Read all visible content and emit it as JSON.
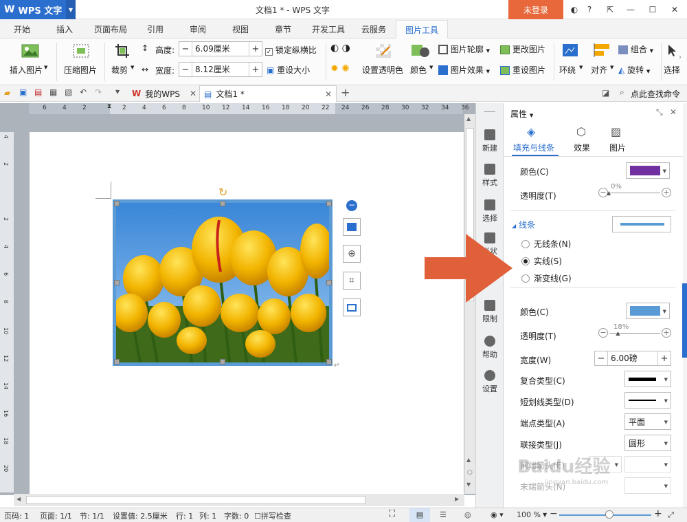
{
  "title_bar": {
    "app_name": "WPS 文字",
    "doc_title": "文档1 * - WPS 文字",
    "login_button": "未登录",
    "help_label": "?"
  },
  "menu_tabs": [
    "开始",
    "插入",
    "页面布局",
    "引用",
    "审阅",
    "视图",
    "章节",
    "开发工具",
    "云服务",
    "图片工具"
  ],
  "active_tab": "图片工具",
  "ribbon": {
    "insert_picture": "插入图片",
    "compress_picture": "压缩图片",
    "crop": "裁剪",
    "height_label": "高度:",
    "height_value": "6.09厘米",
    "width_label": "宽度:",
    "width_value": "8.12厘米",
    "lock_ratio": "锁定纵横比",
    "reset_size": "重设大小",
    "set_transparent": "设置透明色",
    "color": "颜色",
    "picture_outline": "图片轮廓",
    "picture_effect": "图片效果",
    "change_picture": "更改图片",
    "reset_picture": "重设图片",
    "wrap": "环绕",
    "align": "对齐",
    "group": "组合",
    "rotate": "旋转",
    "select": "选择"
  },
  "doc_tabs": {
    "wps_tab": "我的WPS",
    "doc_tab": "文档1 *",
    "search": "点此查找命令"
  },
  "ruler": {
    "h_ticks": [
      "6",
      "4",
      "2",
      "",
      "2",
      "4",
      "6",
      "8",
      "10",
      "12",
      "14",
      "16",
      "18",
      "20",
      "22",
      "24",
      "26",
      "28",
      "30",
      "32",
      "34",
      "36"
    ],
    "v_ticks": [
      "4",
      "2",
      "",
      "2",
      "4",
      "6",
      "8",
      "10",
      "12",
      "14",
      "16",
      "18",
      "20"
    ]
  },
  "side_toolbar": [
    "新建",
    "样式",
    "选择",
    "形状",
    "",
    "限制",
    "帮助",
    "设置"
  ],
  "panel": {
    "header": "属性",
    "tabs": [
      "填充与线条",
      "效果",
      "图片"
    ],
    "fill_color_label": "颜色(C)",
    "fill_color": "#7030a0",
    "fill_transparency_label": "透明度(T)",
    "fill_transparency_value": "0%",
    "fill_transparency": 0,
    "line_section": "线条",
    "line_options": [
      "无线条(N)",
      "实线(S)",
      "渐变线(G)"
    ],
    "line_selected": "实线(S)",
    "line_color_label": "颜色(C)",
    "line_color": "#5b9bd5",
    "line_transparency_label": "透明度(T)",
    "line_transparency_value": "18%",
    "line_transparency": 18,
    "width_label": "宽度(W)",
    "width_value": "6.00磅",
    "compound_label": "复合类型(C)",
    "dash_label": "短划线类型(D)",
    "cap_label": "端点类型(A)",
    "cap_value": "平面",
    "join_label": "联接类型(J)",
    "join_value": "圆形",
    "begin_arrow_label": "前端箭头(E)",
    "end_arrow_label": "末端箭头(N)"
  },
  "status_bar": {
    "page_no": "页码: 1",
    "pages": "页面: 1/1",
    "section": "节: 1/1",
    "setting": "设置值: 2.5厘米",
    "row": "行: 1",
    "col": "列: 1",
    "words": "字数: 0",
    "spell": "拼写检查",
    "zoom": "100 %",
    "zoom_level": 100
  },
  "watermark": "Baidu经验",
  "watermark_url": "jingyan.baidu.com",
  "colors": {
    "accent": "#2b6fce",
    "login": "#e8683c",
    "arrow": "#e0603a",
    "image_border": "#5b9bd5"
  }
}
